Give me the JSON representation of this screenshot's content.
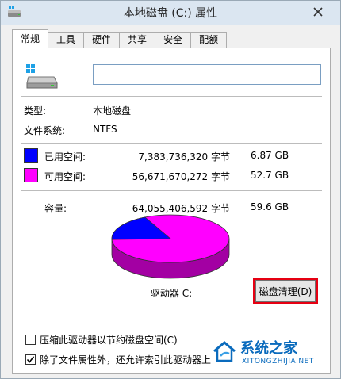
{
  "window": {
    "title": "本地磁盘 (C:) 属性"
  },
  "tabs": [
    {
      "label": "常规",
      "active": true
    },
    {
      "label": "工具",
      "active": false
    },
    {
      "label": "硬件",
      "active": false
    },
    {
      "label": "共享",
      "active": false
    },
    {
      "label": "安全",
      "active": false
    },
    {
      "label": "配额",
      "active": false
    }
  ],
  "general": {
    "volume_name_value": "",
    "type_label": "类型:",
    "type_value": "本地磁盘",
    "fs_label": "文件系统:",
    "fs_value": "NTFS",
    "used_label": "已用空间:",
    "used_bytes": "7,383,736,320 字节",
    "used_size": "6.87 GB",
    "free_label": "可用空间:",
    "free_bytes": "56,671,670,272 字节",
    "free_size": "52.7 GB",
    "capacity_label": "容量:",
    "capacity_bytes": "64,055,406,592 字节",
    "capacity_size": "59.6 GB",
    "drive_label": "驱动器 C:",
    "cleanup_button": "磁盘清理(D)",
    "compress_label": "压缩此驱动器以节约磁盘空间(C)",
    "compress_checked": false,
    "index_label": "除了文件属性外，还允许索引此驱动器上",
    "index_checked": true
  },
  "colors": {
    "used": "#0000ff",
    "free": "#ff00ff",
    "highlight": "#e60012"
  },
  "disk_usage": {
    "used_fraction": 0.1153
  },
  "watermark": {
    "brand": "系统之家",
    "url": "XITONGZHIJIA.NET"
  }
}
